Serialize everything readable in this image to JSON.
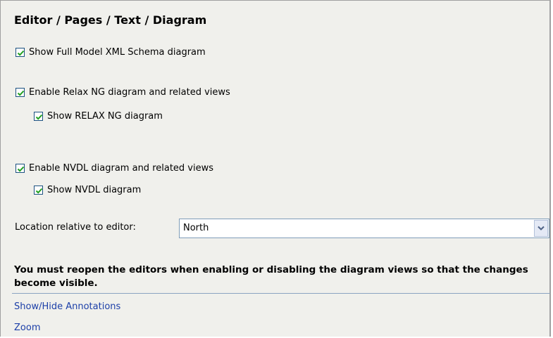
{
  "page": {
    "title": "Editor / Pages / Text / Diagram"
  },
  "options": {
    "full_model": {
      "label": "Show Full Model XML Schema diagram",
      "checked": true
    },
    "enable_relax_ng": {
      "label": "Enable Relax NG diagram and related views",
      "checked": true
    },
    "show_relax_ng": {
      "label": "Show RELAX NG diagram",
      "checked": true
    },
    "enable_nvdl": {
      "label": "Enable NVDL diagram and related views",
      "checked": true
    },
    "show_nvdl": {
      "label": "Show NVDL diagram",
      "checked": true
    }
  },
  "location": {
    "label": "Location relative to editor:",
    "value": "North"
  },
  "warning": "You must reopen the editors when enabling or disabling the diagram views so that the changes become visible.",
  "links": {
    "annotations": "Show/Hide Annotations",
    "zoom": "Zoom"
  },
  "colors": {
    "panel_background": "#f0f0ec",
    "check_mark": "#21a121",
    "link": "#1c3fa8",
    "divider": "#8aa3c1"
  }
}
